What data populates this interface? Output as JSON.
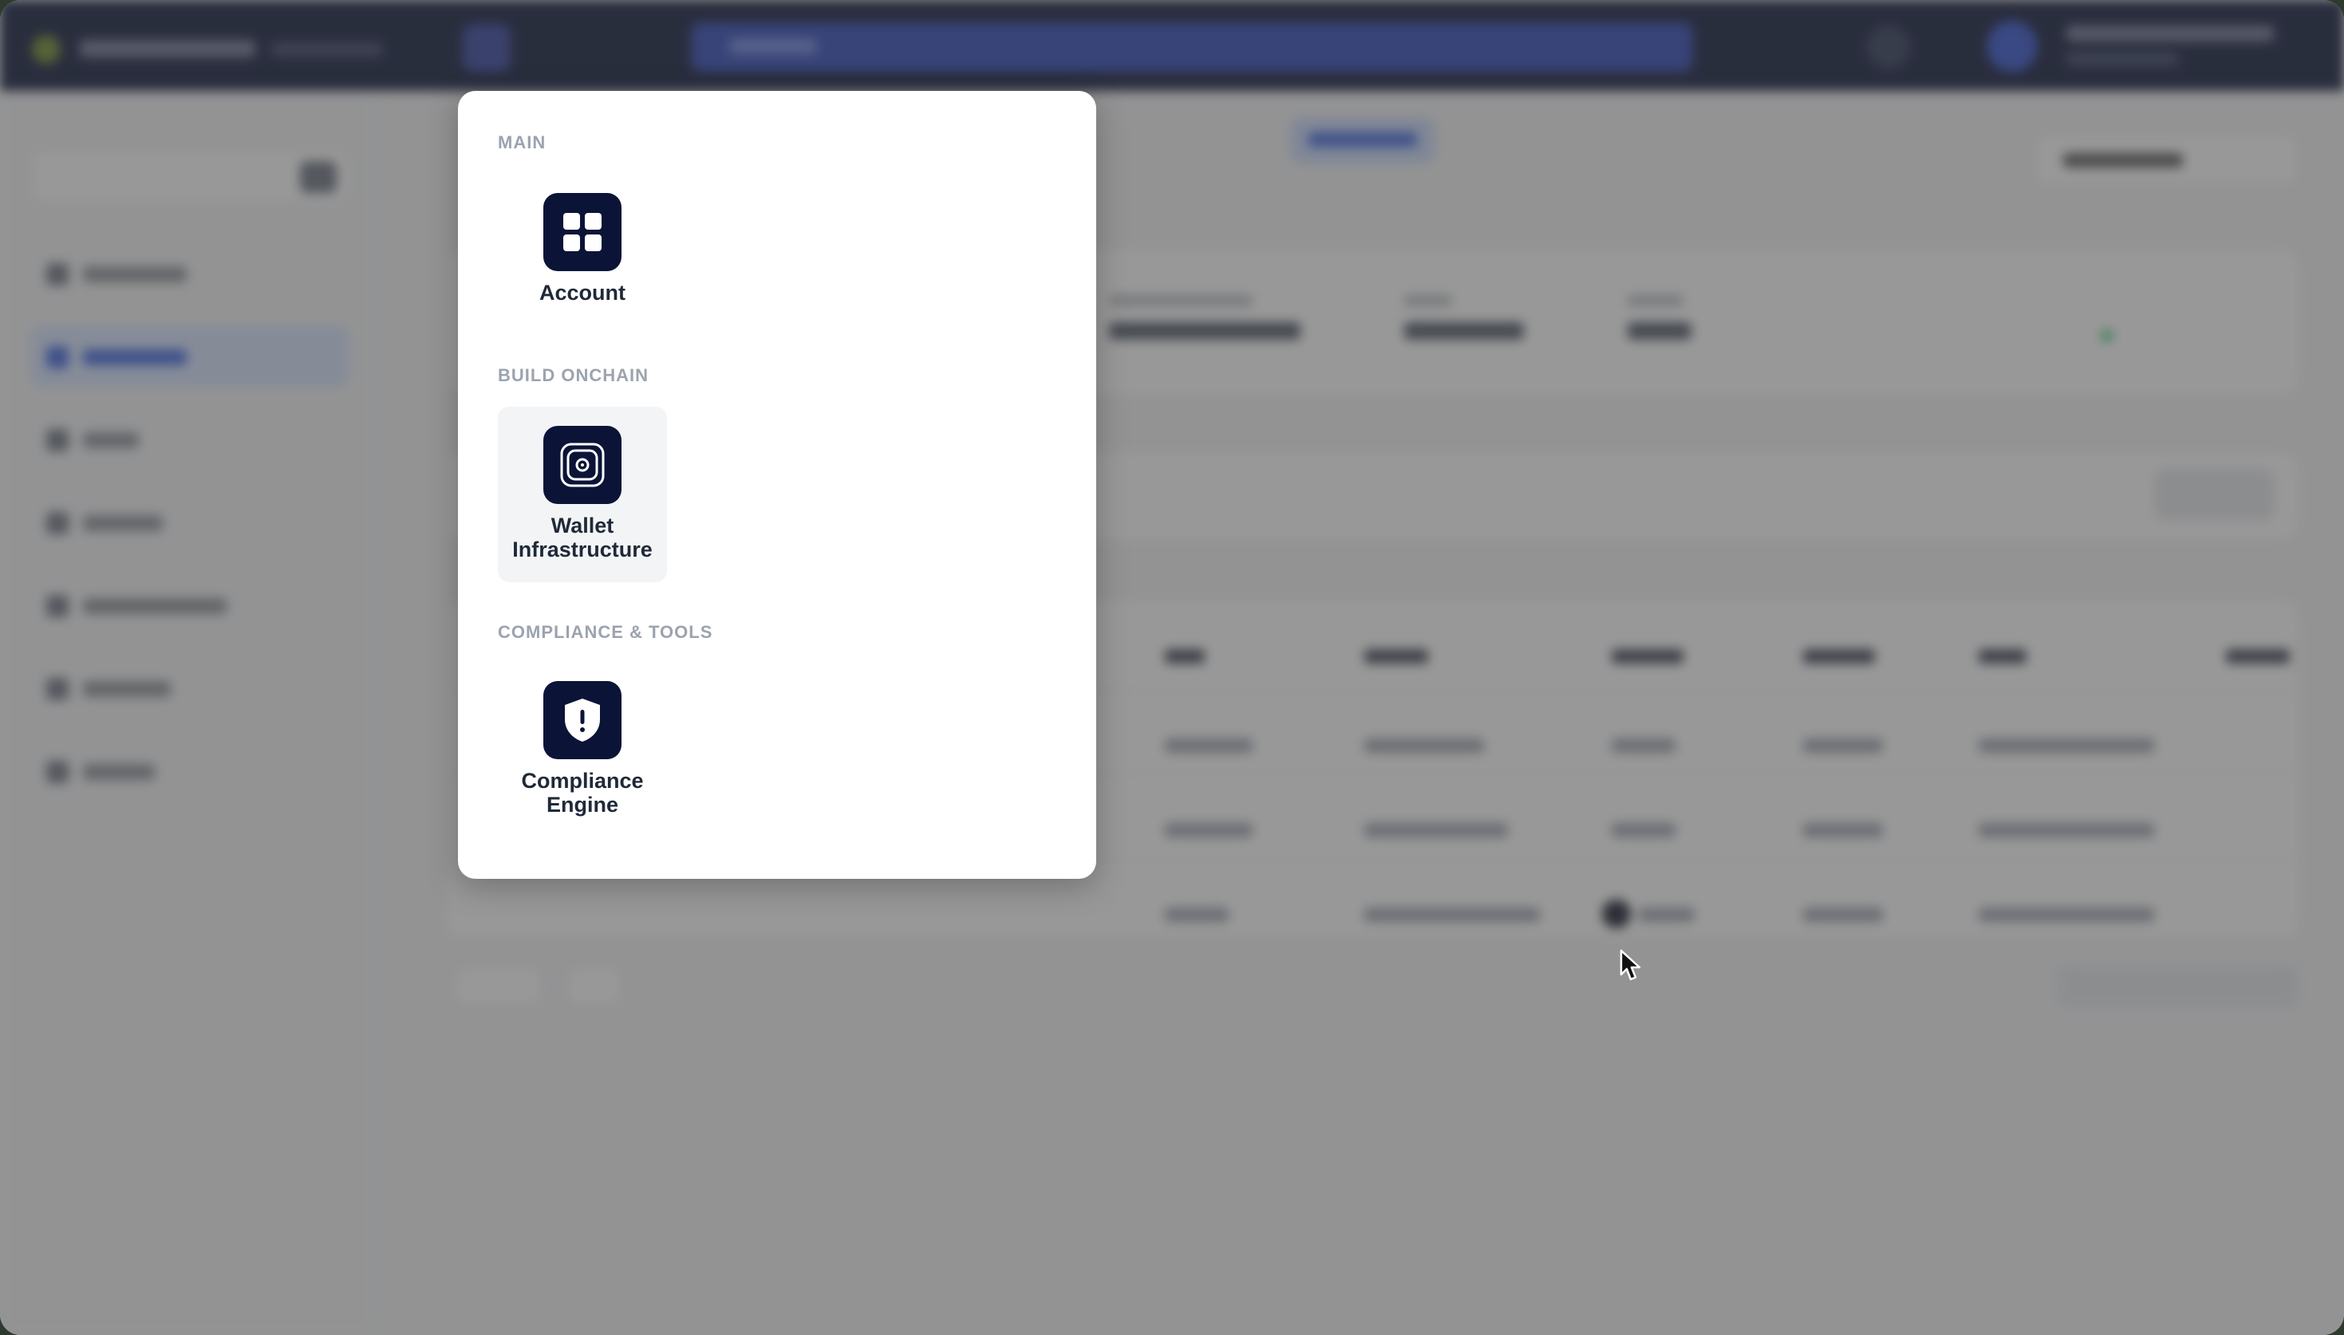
{
  "apps_menu": {
    "sections": [
      {
        "title": "MAIN",
        "apps": [
          {
            "label": "Account",
            "icon": "grid-icon"
          }
        ]
      },
      {
        "title": "BUILD ONCHAIN",
        "apps": [
          {
            "label": "Wallet Infrastructure",
            "icon": "vault-icon"
          }
        ]
      },
      {
        "title": "COMPLIANCE & TOOLS",
        "apps": [
          {
            "label": "Compliance Engine",
            "icon": "shield-alert-icon"
          }
        ]
      }
    ]
  },
  "colors": {
    "icon_bg": "#0b1437",
    "section_title": "#9ca3af",
    "tile_hover": "#f3f4f6",
    "topbar": "#0b1437",
    "accent": "#3b64e0"
  }
}
